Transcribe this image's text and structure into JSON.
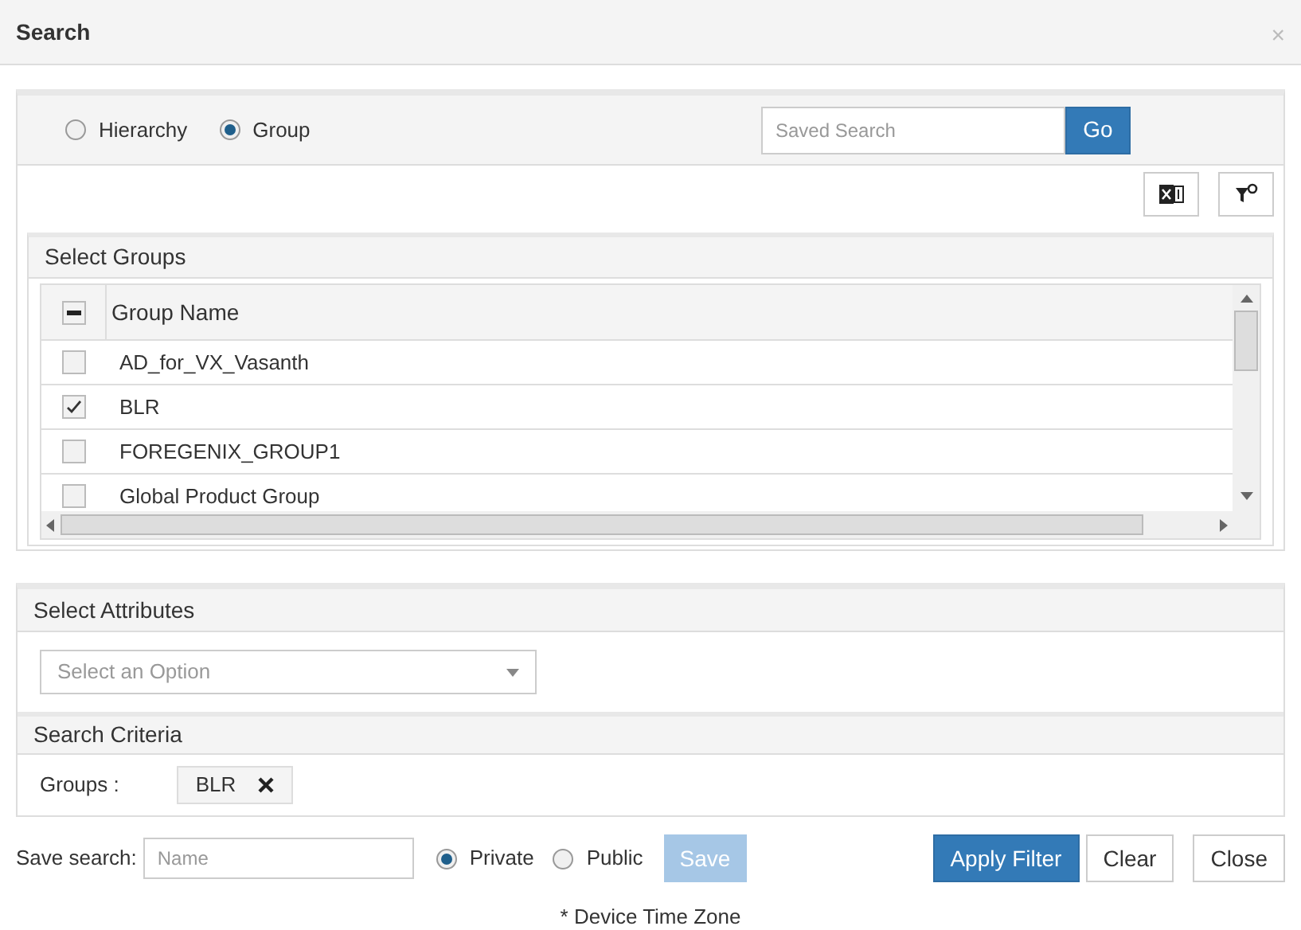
{
  "dialog": {
    "title": "Search",
    "close": "×"
  },
  "mode_options": [
    {
      "label": "Hierarchy",
      "selected": false
    },
    {
      "label": "Group",
      "selected": true
    }
  ],
  "saved_search": {
    "placeholder": "Saved Search",
    "button": "Go"
  },
  "select_groups": {
    "title": "Select Groups",
    "header_checkbox": {
      "indeterminate": true
    },
    "column": "Group Name",
    "rows": [
      {
        "name": "AD_for_VX_Vasanth",
        "checked": false
      },
      {
        "name": "BLR",
        "checked": true
      },
      {
        "name": "FOREGENIX_GROUP1",
        "checked": false
      },
      {
        "name": "Global Product Group",
        "checked": false
      }
    ]
  },
  "select_attributes": {
    "title": "Select Attributes",
    "placeholder": "Select an Option"
  },
  "search_criteria": {
    "title": "Search Criteria",
    "label": "Groups :",
    "tags": [
      "BLR"
    ]
  },
  "footer": {
    "save_label": "Save search:",
    "name_placeholder": "Name",
    "visibility": [
      {
        "label": "Private",
        "selected": true
      },
      {
        "label": "Public",
        "selected": false
      }
    ],
    "save": {
      "label": "Save",
      "disabled": true
    },
    "buttons": [
      {
        "label": "Apply Filter",
        "kind": "primary"
      },
      {
        "label": "Clear",
        "kind": "default"
      },
      {
        "label": "Close",
        "kind": "default"
      }
    ]
  },
  "note": "* Device Time Zone"
}
